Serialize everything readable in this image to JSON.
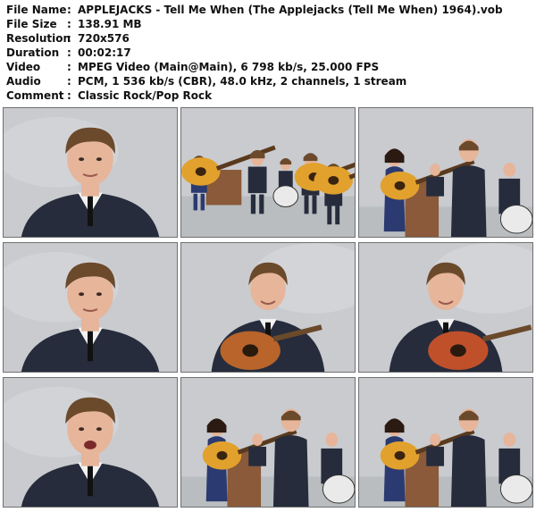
{
  "info": [
    {
      "label": "File Name",
      "colon": ":",
      "value": "APPLEJACKS - Tell Me When (The Applejacks (Tell Me When) 1964).vob"
    },
    {
      "label": "File Size",
      "colon": ":",
      "value": "138.91 MB"
    },
    {
      "label": "Resolution",
      "colon": ":",
      "value": "720x576"
    },
    {
      "label": "Duration",
      "colon": ":",
      "value": "00:02:17"
    },
    {
      "label": "Video",
      "colon": ":",
      "value": "MPEG Video (Main@Main), 6 798 kb/s, 25.000 FPS"
    },
    {
      "label": "Audio",
      "colon": ":",
      "value": "PCM, 1 536 kb/s (CBR), 48.0 kHz, 2 channels, 1 stream"
    },
    {
      "label": "Comment",
      "colon": ":",
      "value": "Classic Rock/Pop Rock"
    }
  ],
  "colors": {
    "backdrop": "#c9cbcf",
    "suit": "#262c3c",
    "skin": "#e6b59a",
    "hair": "#6b4a2c",
    "dress": "#2b3a70",
    "guitar": "#e1a12c",
    "floor": "#b9bdbf",
    "border": "#707070"
  },
  "thumbnails": [
    {
      "scene": "closeup-singer"
    },
    {
      "scene": "full-band"
    },
    {
      "scene": "band-mid"
    },
    {
      "scene": "closeup-singer"
    },
    {
      "scene": "guitarist"
    },
    {
      "scene": "guitarist-red"
    },
    {
      "scene": "closeup-singer-open"
    },
    {
      "scene": "band-mid"
    },
    {
      "scene": "band-mid"
    }
  ]
}
